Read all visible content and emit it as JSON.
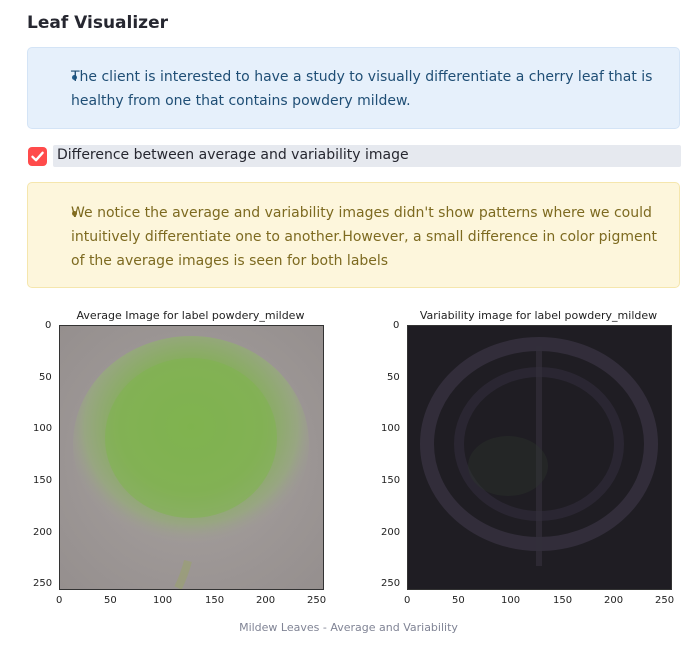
{
  "header": {
    "title": "Leaf Visualizer"
  },
  "info_box": {
    "text": "The client is interested to have a study to visually differentiate a cherry leaf that is healthy from one that contains powdery mildew."
  },
  "checkbox": {
    "label": "Difference between average and variability image",
    "checked": true,
    "accent": "#ff4b4b"
  },
  "warning_box": {
    "text": "We notice the average and variability images didn't show patterns where we could intuitively differentiate one to another.However, a small difference in color pigment of the average images is seen for both labels"
  },
  "figure": {
    "caption": "Mildew Leaves - Average and Variability",
    "left_plot": {
      "title": "Average Image for label powdery_mildew"
    },
    "right_plot": {
      "title": "Variability image for label powdery_mildew"
    },
    "y_ticks": [
      "0",
      "50",
      "100",
      "150",
      "200",
      "250"
    ],
    "x_ticks": [
      "0",
      "50",
      "100",
      "150",
      "200",
      "250"
    ]
  }
}
